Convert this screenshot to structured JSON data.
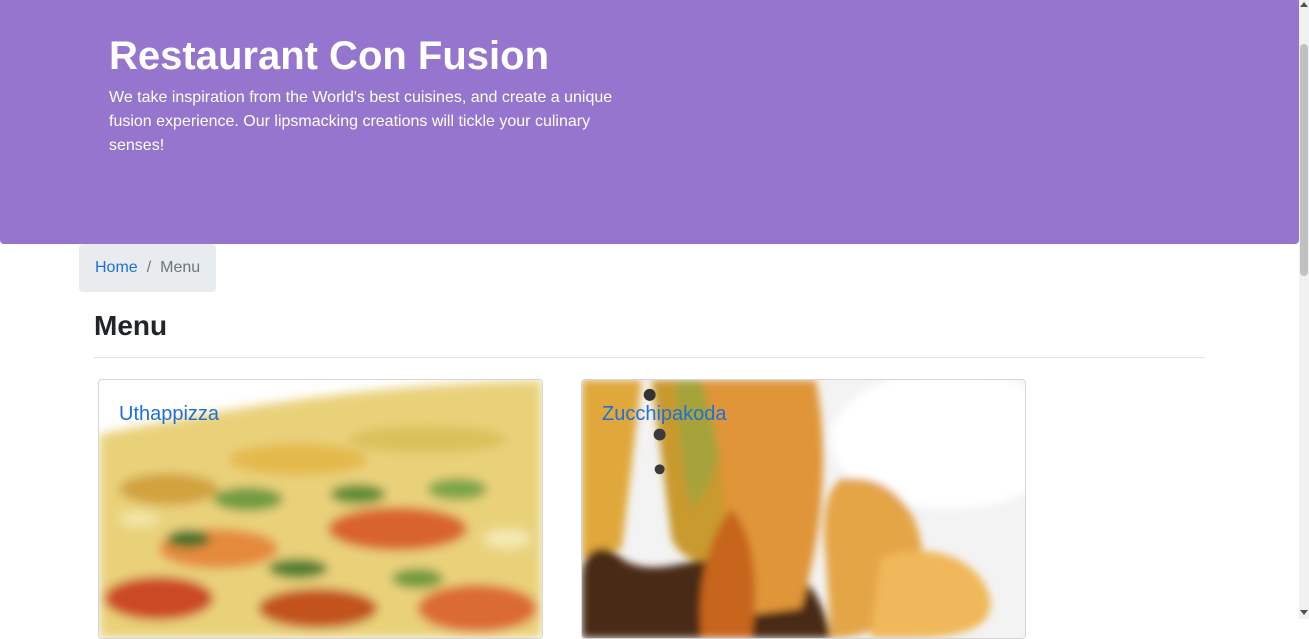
{
  "header": {
    "title": "Restaurant Con Fusion",
    "tagline": "We take inspiration from the World's best cuisines, and create a unique fusion experience. Our lipsmacking creations will tickle your culinary senses!"
  },
  "breadcrumb": {
    "home": "Home",
    "separator": "/",
    "current": "Menu"
  },
  "page": {
    "title": "Menu"
  },
  "dishes": [
    {
      "name": "Uthappizza",
      "image": "pizza-image"
    },
    {
      "name": "Zucchipakoda",
      "image": "fritter-dip-image"
    }
  ],
  "colors": {
    "jumbotron": "#9575cd",
    "link": "#1e6fd9",
    "breadcrumb_bg": "#e9ecef"
  }
}
